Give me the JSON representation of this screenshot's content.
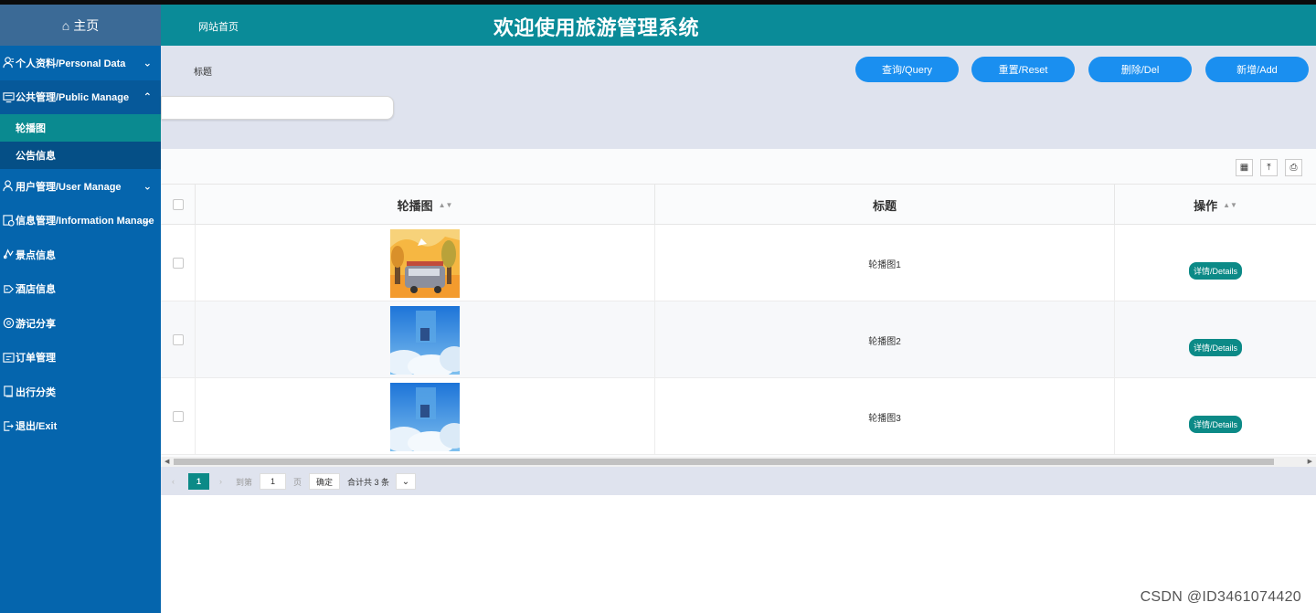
{
  "sidebar": {
    "home": "主页",
    "items": [
      {
        "label": "个人资料/Personal Data",
        "icon": "user-icon",
        "chevron": "down"
      },
      {
        "label": "公共管理/Public Manage",
        "icon": "monitor-icon",
        "chevron": "up"
      },
      {
        "label": "用户管理/User Manage",
        "icon": "user-icon",
        "chevron": "down"
      },
      {
        "label": "信息管理/Information Manage",
        "icon": "settings-icon",
        "chevron": "down"
      },
      {
        "label": "景点信息",
        "icon": "map-icon"
      },
      {
        "label": "酒店信息",
        "icon": "hotel-icon"
      },
      {
        "label": "游记分享",
        "icon": "share-icon"
      },
      {
        "label": "订单管理",
        "icon": "order-icon"
      },
      {
        "label": "出行分类",
        "icon": "copy-icon"
      },
      {
        "label": "退出/Exit",
        "icon": "exit-icon"
      }
    ],
    "subitems": [
      {
        "label": "轮播图",
        "active": true
      },
      {
        "label": "公告信息",
        "active": false
      }
    ]
  },
  "header": {
    "link": "网站首页",
    "title": "欢迎使用旅游管理系统"
  },
  "search": {
    "label": "标题",
    "input_value": "",
    "buttons": {
      "query": "查询/Query",
      "reset": "重置/Reset",
      "delete": "删除/Del",
      "add": "新增/Add"
    }
  },
  "table": {
    "columns": [
      "轮播图",
      "标题",
      "操作"
    ],
    "rows": [
      {
        "title": "轮播图1",
        "thumb": "van-autumn",
        "action": "详情/Details"
      },
      {
        "title": "轮播图2",
        "thumb": "sky-clouds",
        "action": "详情/Details"
      },
      {
        "title": "轮播图3",
        "thumb": "sky-clouds",
        "action": "详情/Details"
      }
    ]
  },
  "pagination": {
    "current": "1",
    "goto": "到第",
    "page_input": "1",
    "page_unit": "页",
    "confirm": "确定",
    "total": "合计共 3 条"
  },
  "watermark": "CSDN @ID3461074420",
  "colors": {
    "sidebar": "#0565ad",
    "header": "#0a8b98",
    "button": "#1a8ff0",
    "accent": "#0c8a87"
  }
}
